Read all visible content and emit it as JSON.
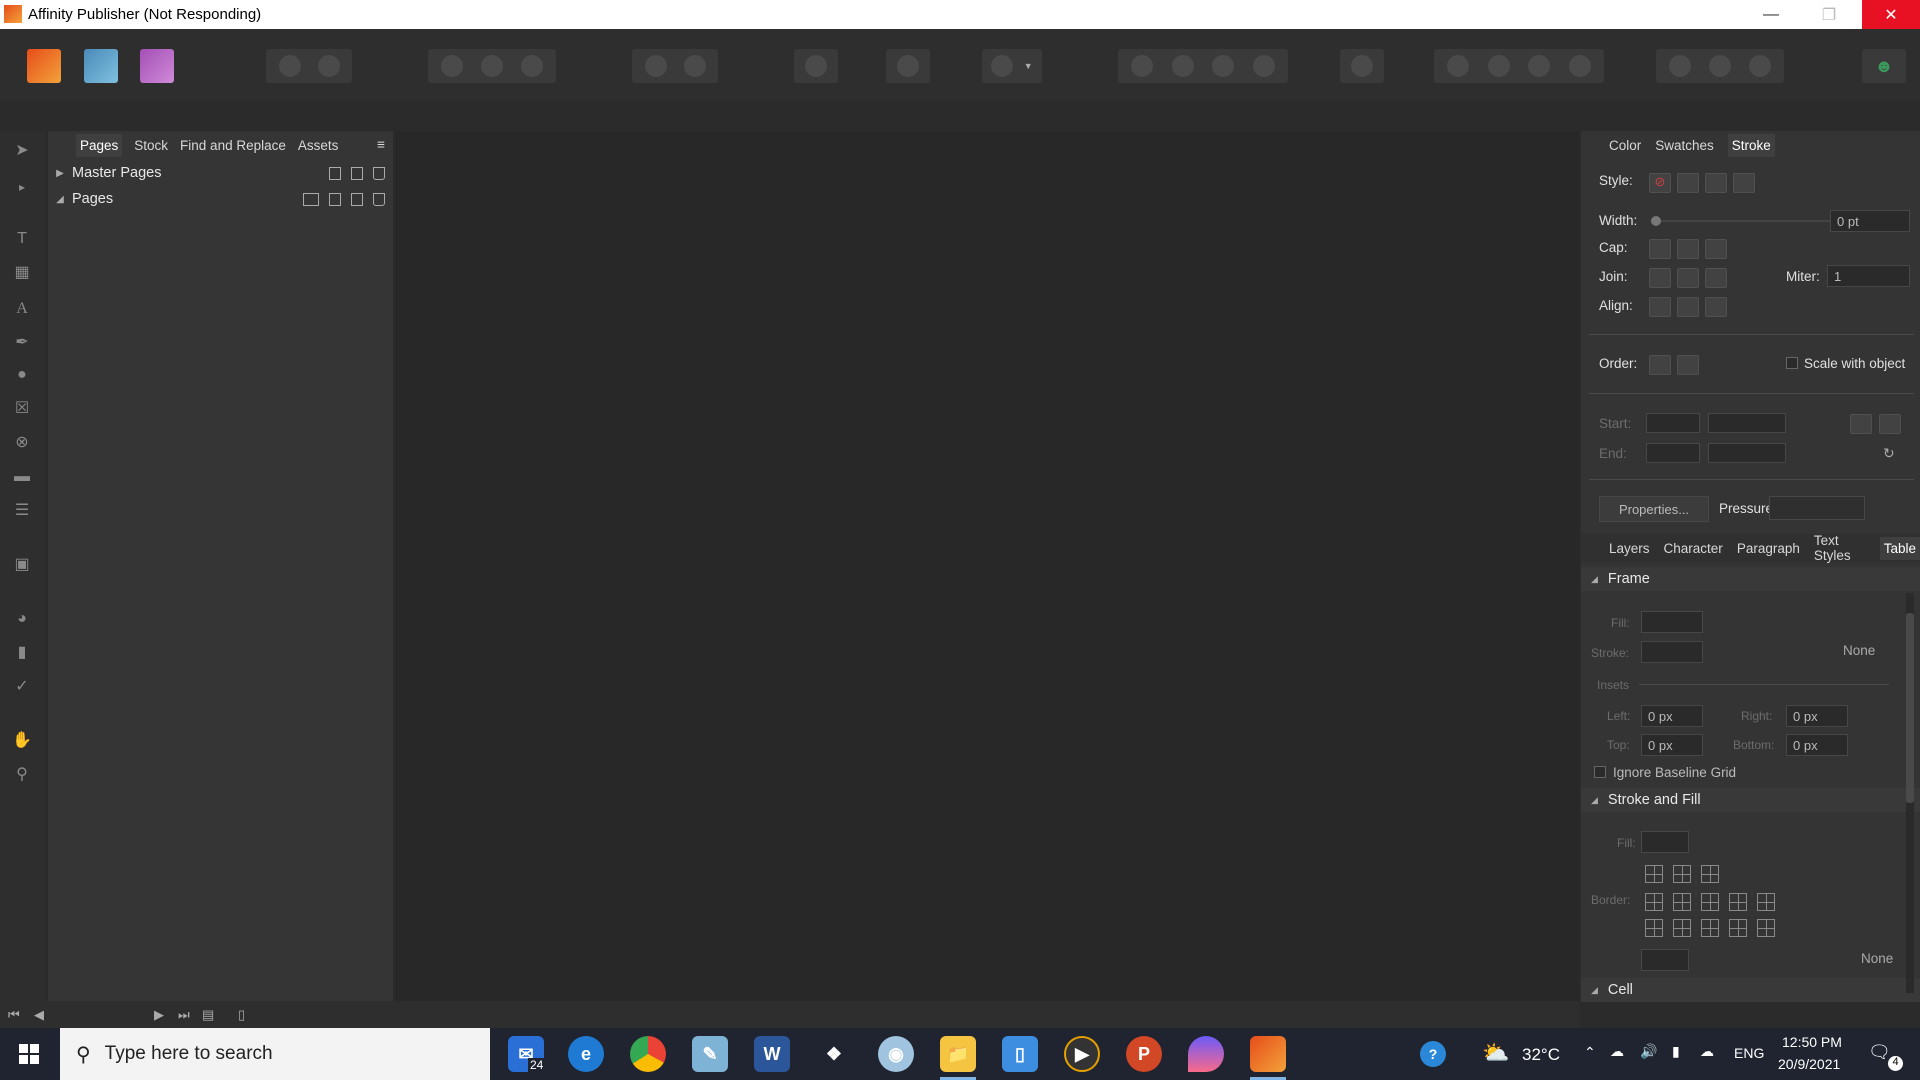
{
  "window": {
    "title": "Affinity Publisher (Not Responding)"
  },
  "pages_panel": {
    "tabs": [
      "Pages",
      "Stock",
      "Find and Replace",
      "Assets"
    ],
    "active_tab": "Pages",
    "items": [
      {
        "label": "Master Pages",
        "expanded": false
      },
      {
        "label": "Pages",
        "expanded": true
      }
    ]
  },
  "right_top": {
    "tabs": [
      "Color",
      "Swatches",
      "Stroke"
    ],
    "active_tab": "Stroke",
    "style_label": "Style:",
    "width_label": "Width:",
    "width_value": "0 pt",
    "cap_label": "Cap:",
    "join_label": "Join:",
    "miter_label": "Miter:",
    "miter_value": "1",
    "align_label": "Align:",
    "order_label": "Order:",
    "scale_label": "Scale with object",
    "start_label": "Start:",
    "end_label": "End:",
    "properties_label": "Properties...",
    "pressure_label": "Pressure:"
  },
  "right_bottom": {
    "tabs": [
      "Layers",
      "Character",
      "Paragraph",
      "Text Styles",
      "Table"
    ],
    "active_tab": "Table",
    "frame_title": "Frame",
    "fill_label": "Fill:",
    "stroke_label": "Stroke:",
    "stroke_none": "None",
    "insets_label": "Insets",
    "left_label": "Left:",
    "left_value": "0 px",
    "right_label": "Right:",
    "right_value": "0 px",
    "top_label": "Top:",
    "top_value": "0 px",
    "bottom_label": "Bottom:",
    "bottom_value": "0 px",
    "ignore_label": "Ignore Baseline Grid",
    "stroke_fill_title": "Stroke and Fill",
    "sf_fill_label": "Fill:",
    "border_label": "Border:",
    "border_none": "None",
    "cell_title": "Cell"
  },
  "taskbar": {
    "search_placeholder": "Type here to search",
    "mail_badge": "24",
    "temperature": "32°C",
    "language": "ENG",
    "time": "12:50 PM",
    "date": "20/9/2021",
    "notif_count": "4"
  },
  "colors": {
    "accent": "#3b9a5b",
    "publisher_icon": "#e64d1a",
    "close_red": "#e81123"
  }
}
